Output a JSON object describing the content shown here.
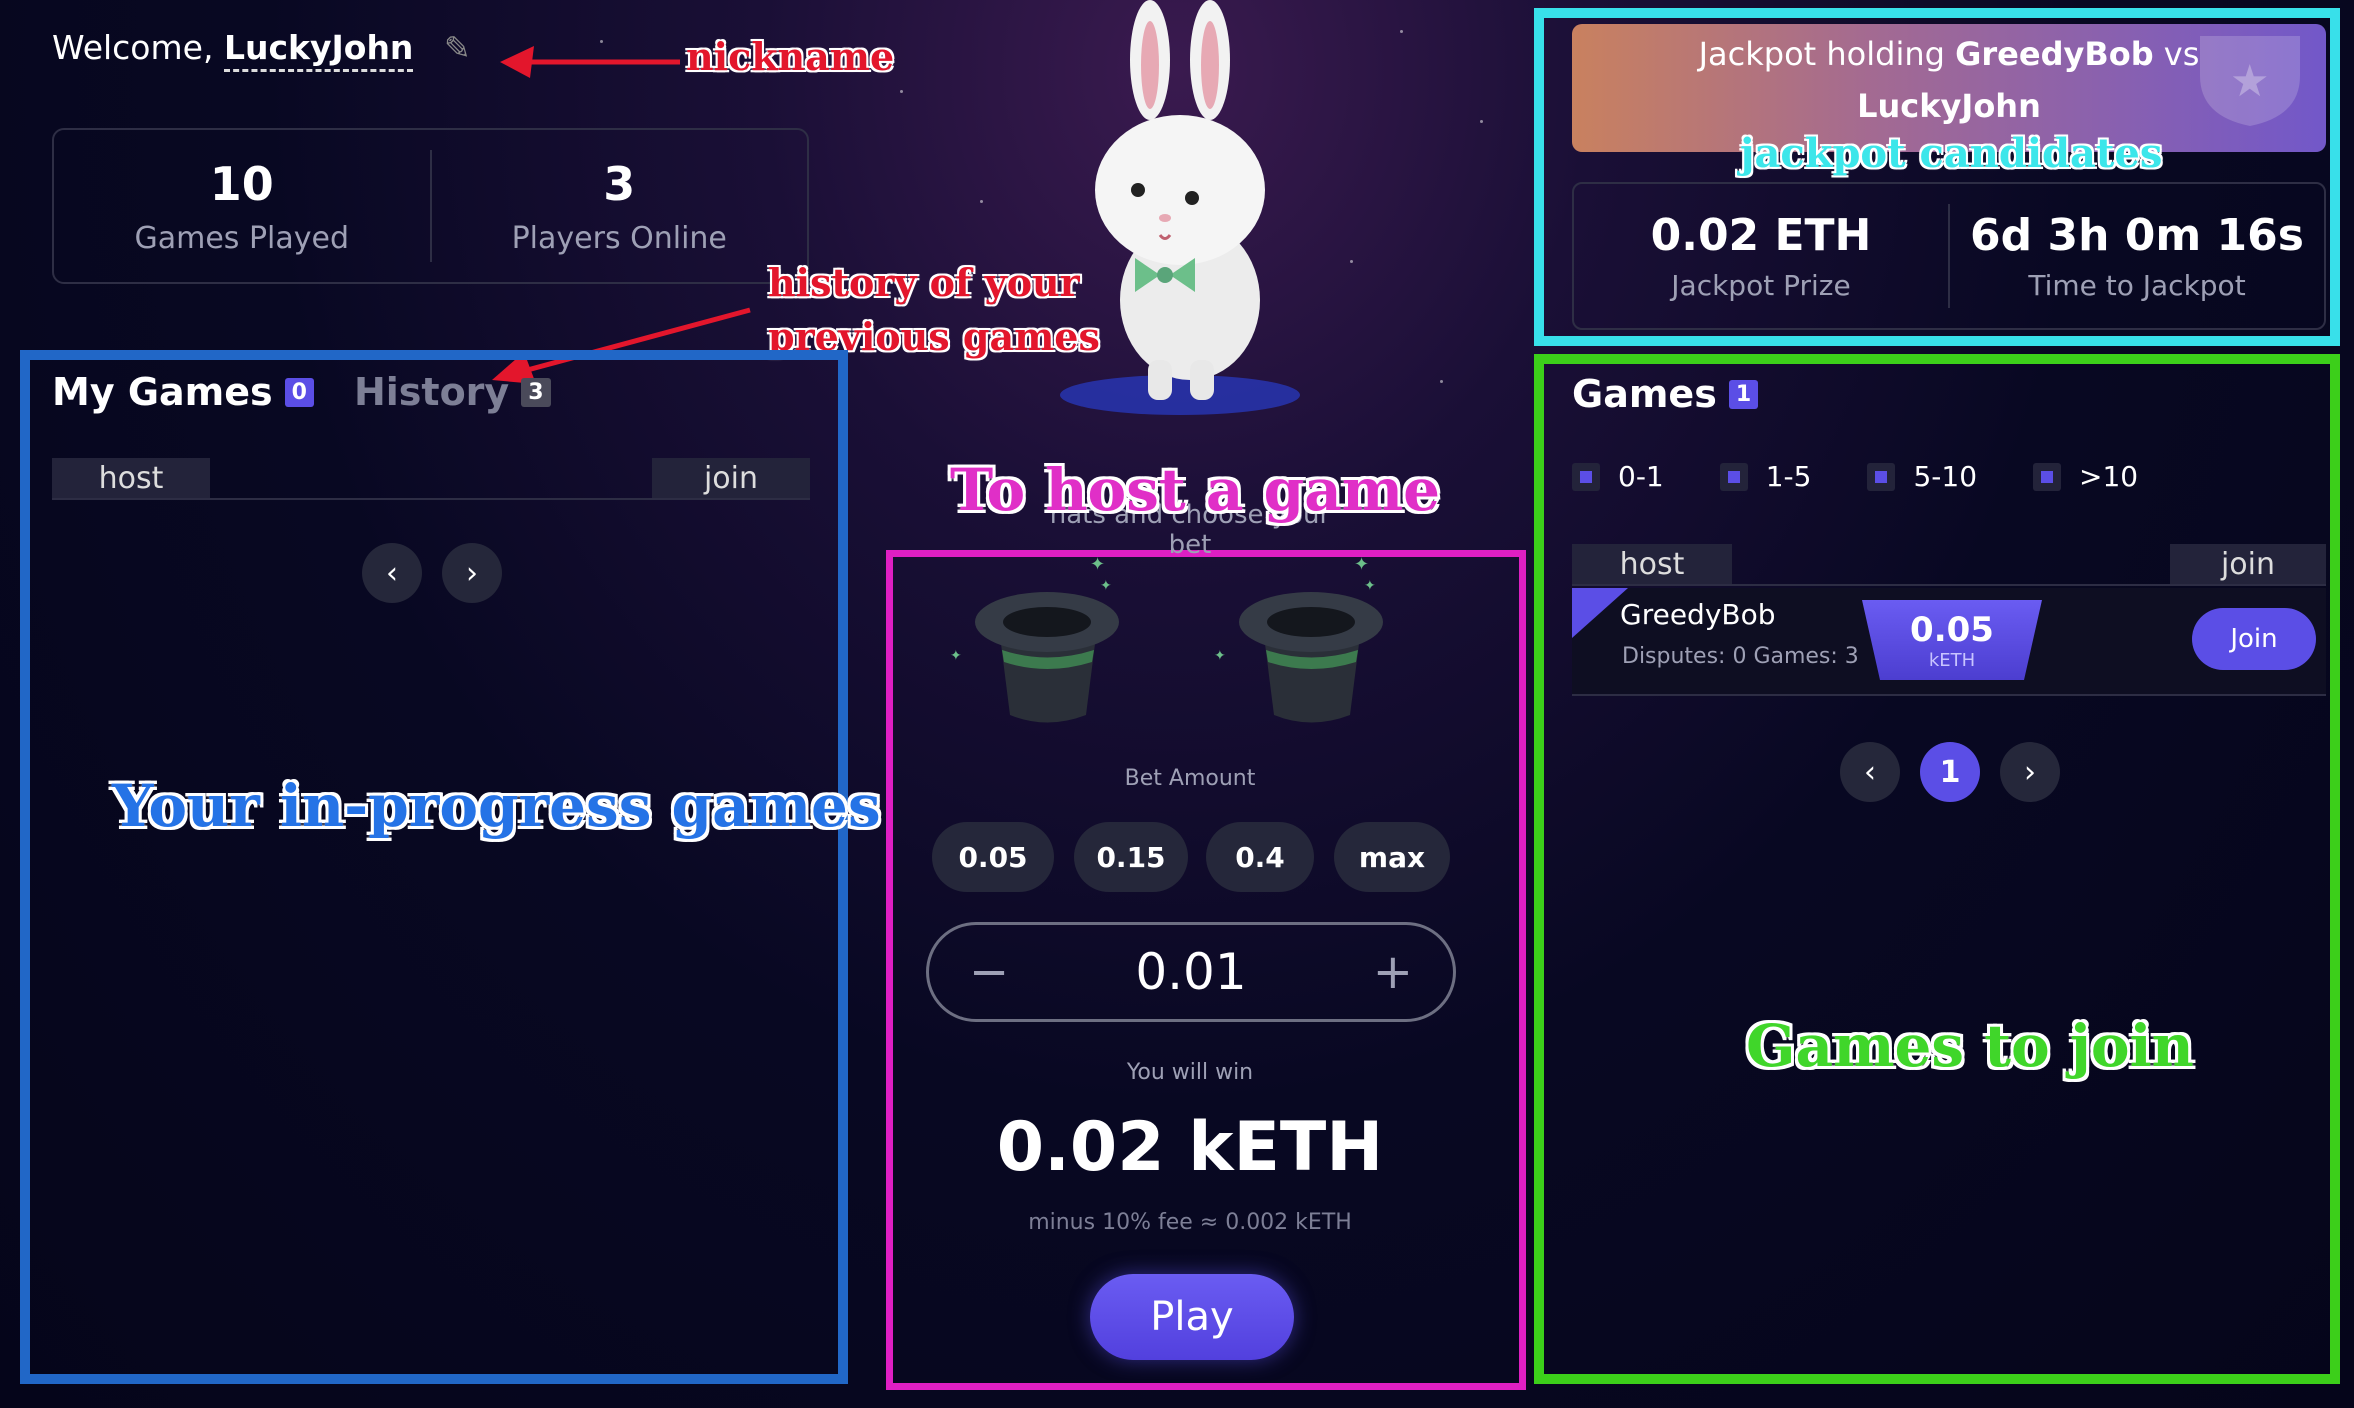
{
  "header": {
    "welcome_prefix": "Welcome,",
    "nickname": "LuckyJohn",
    "edit_icon": "pencil-icon"
  },
  "stats": [
    {
      "value": "10",
      "label": "Games Played"
    },
    {
      "value": "3",
      "label": "Players Online"
    }
  ],
  "my_games": {
    "tabs": [
      {
        "label": "My Games",
        "count": "0"
      },
      {
        "label": "History",
        "count": "3"
      }
    ],
    "host_label": "host",
    "join_label": "join"
  },
  "host_panel": {
    "partial_text": "hats and choose your bet",
    "bet_amount_label": "Bet Amount",
    "chips": [
      "0.05",
      "0.15",
      "0.4",
      "max"
    ],
    "stepper_value": "0.01",
    "you_will_win_label": "You will win",
    "win_amount": "0.02 kETH",
    "fee_text": "minus 10% fee ≈ 0.002 kETH",
    "play_label": "Play"
  },
  "jackpot": {
    "title_prefix": "Jackpot holding",
    "candidate1": "GreedyBob",
    "vs": "vs",
    "candidate2": "LuckyJohn",
    "prize": "0.02 ETH",
    "prize_label": "Jackpot Prize",
    "time": "6d 3h 0m 16s",
    "time_label": "Time to Jackpot"
  },
  "games": {
    "title": "Games",
    "count": "1",
    "filters": [
      "0-1",
      "1-5",
      "5-10",
      ">10"
    ],
    "host_label": "host",
    "join_label": "join",
    "rows": [
      {
        "name": "GreedyBob",
        "info": "Disputes: 0 Games: 3",
        "bet": "0.05",
        "unit": "kETH",
        "join": "Join"
      }
    ],
    "page": "1"
  },
  "annotations": {
    "nickname": "nickname",
    "history_line1": "history of your",
    "history_line2": "previous games",
    "in_progress": "Your in-progress games",
    "host_game": "To host a game",
    "jackpot_candidates": "jackpot candidates",
    "games_to_join": "Games to join"
  },
  "colors": {
    "accent": "#5b4ee6",
    "frame_blue": "#2167c7",
    "frame_pink": "#df1fc3",
    "frame_cyan": "#38e0ea",
    "frame_green": "#3ccf1a",
    "annotation_red": "#e3162c"
  }
}
